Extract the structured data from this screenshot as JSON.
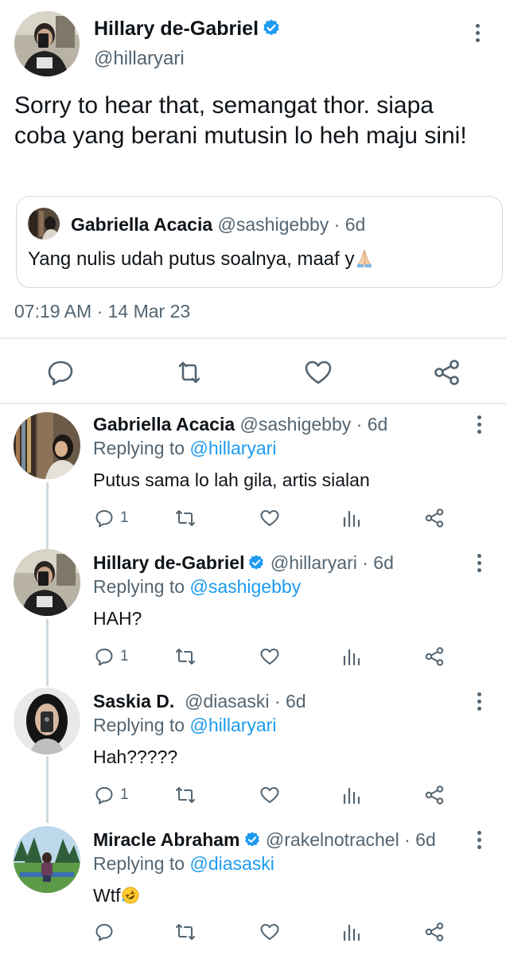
{
  "main_tweet": {
    "author_name": "Hillary de-Gabriel",
    "author_handle": "@hillaryari",
    "text": "Sorry to hear that, semangat thor. siapa coba yang berani mutusin lo heh maju sini!",
    "quoted": {
      "author_name": "Gabriella Acacia",
      "author_handle": "@sashigebby",
      "time": "6d",
      "text": "Yang nulis udah putus soalnya, maaf y",
      "emoji": "folded-hands"
    },
    "timestamp": "07:19 AM · 14 Mar 23",
    "actions": [
      "comment-icon",
      "retweet-icon",
      "like-icon",
      "share-icon"
    ]
  },
  "replies": [
    {
      "author_name": "Gabriella Acacia",
      "author_handle": "@sashigebby",
      "time": "6d",
      "replying_prefix": "Replying to",
      "replying_to": "@hillaryari",
      "text": "Putus sama lo lah gila, artis sialan",
      "reply_count": "1"
    },
    {
      "author_name": "Hillary de-Gabriel",
      "verified": true,
      "author_handle": "@hillaryari",
      "time": "6d",
      "replying_prefix": "Replying to",
      "replying_to": "@sashigebby",
      "text": "HAH?",
      "reply_count": "1"
    },
    {
      "author_name": "Saskia D.",
      "author_handle": "@diasaski",
      "time": "6d",
      "replying_prefix": "Replying to",
      "replying_to": "@hillaryari",
      "text": "Hah?????",
      "reply_count": "1"
    },
    {
      "author_name": "Miracle Abraham",
      "verified": true,
      "author_handle": "@rakelnotrachel",
      "time": "6d",
      "replying_prefix": "Replying to",
      "replying_to": "@diasaski",
      "text": "Wtf",
      "emoji": "rolling-on-floor-laughing",
      "reply_count": ""
    }
  ],
  "colors": {
    "accent": "#1d9bf0",
    "muted": "#536471",
    "divider": "#e6ebee"
  }
}
